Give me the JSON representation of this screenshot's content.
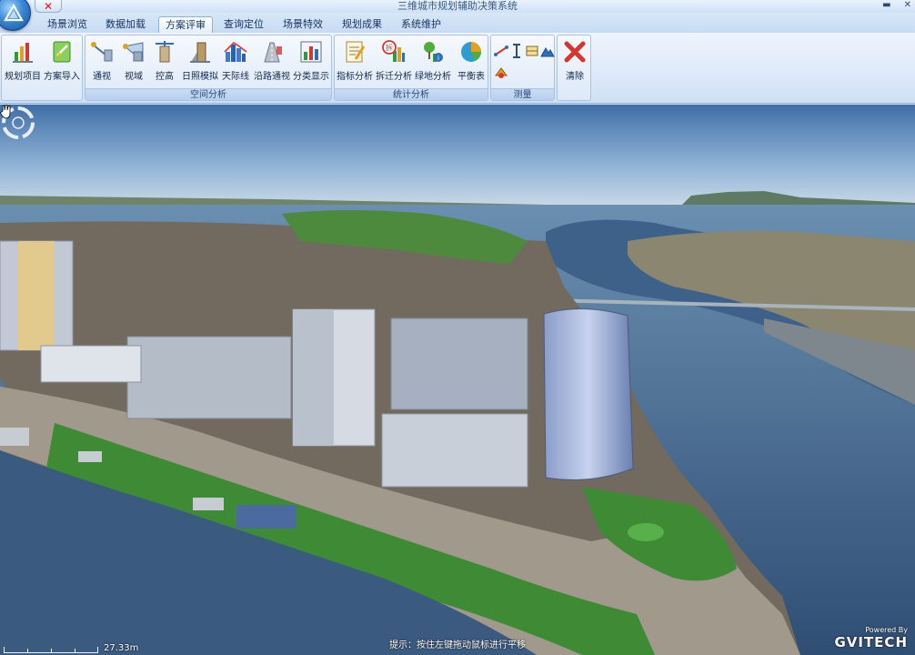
{
  "window": {
    "title": "三维城市规划辅助决策系统",
    "qat_close": "✕",
    "minimize": "▬",
    "close": "✕"
  },
  "tabs": [
    {
      "label": "场景浏览",
      "active": false
    },
    {
      "label": "数据加载",
      "active": false
    },
    {
      "label": "方案评审",
      "active": true
    },
    {
      "label": "查询定位",
      "active": false
    },
    {
      "label": "场景特效",
      "active": false
    },
    {
      "label": "规划成果",
      "active": false
    },
    {
      "label": "系统维护",
      "active": false
    }
  ],
  "ribbon": {
    "project_group": {
      "label": "",
      "buttons": [
        {
          "label": "规划项目",
          "icon": "bar-chart-icon"
        },
        {
          "label": "方案导入",
          "icon": "import-icon"
        }
      ]
    },
    "spatial_group": {
      "label": "空间分析",
      "buttons": [
        {
          "label": "通视",
          "icon": "line-of-sight-icon"
        },
        {
          "label": "视域",
          "icon": "viewshed-icon"
        },
        {
          "label": "控高",
          "icon": "height-control-icon"
        },
        {
          "label": "日照模拟",
          "icon": "sunlight-icon"
        },
        {
          "label": "天际线",
          "icon": "skyline-icon"
        },
        {
          "label": "沿路通视",
          "icon": "road-sight-icon"
        },
        {
          "label": "分类显示",
          "icon": "classify-icon"
        }
      ]
    },
    "stats_group": {
      "label": "统计分析",
      "buttons": [
        {
          "label": "指标分析",
          "icon": "indicator-icon"
        },
        {
          "label": "拆迁分析",
          "icon": "demolition-icon"
        },
        {
          "label": "绿地分析",
          "icon": "greenland-icon"
        },
        {
          "label": "平衡表",
          "icon": "pie-chart-icon"
        }
      ]
    },
    "measure_group": {
      "label": "测量",
      "buttons": [
        "distance-icon",
        "height-icon",
        "area-icon",
        "terrain-icon",
        "volume-icon"
      ]
    },
    "clear_group": {
      "label": "",
      "buttons": [
        {
          "label": "清除",
          "icon": "clear-icon"
        }
      ]
    }
  },
  "viewport": {
    "scale_text": "27.33m",
    "hint": "提示：按住左键拖动鼠标进行平移",
    "brand_small": "Powered By",
    "brand_big": "GVITECH"
  },
  "colors": {
    "accent": "#2f6fb8",
    "clear_red": "#d31e1e",
    "sky_top": "#3f6ea6",
    "water": "#3a5c85"
  }
}
